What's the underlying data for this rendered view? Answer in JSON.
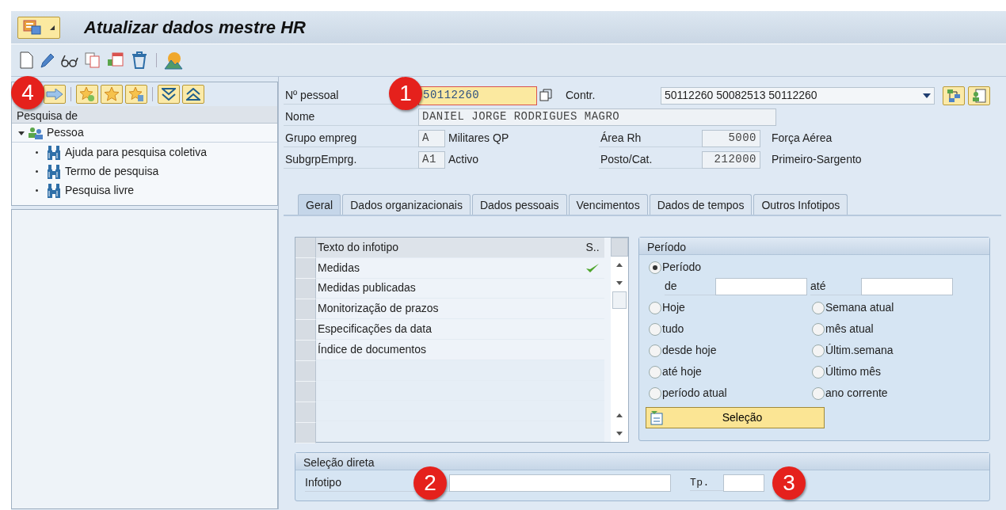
{
  "title_bar": {
    "title": "Atualizar dados mestre HR"
  },
  "search_panel": {
    "header": "Pesquisa de",
    "tree": [
      {
        "label": "Pessoa",
        "expanded": true,
        "children": [
          {
            "label": "Ajuda para pesquisa coletiva"
          },
          {
            "label": "Termo de pesquisa"
          },
          {
            "label": "Pesquisa livre"
          }
        ]
      }
    ]
  },
  "header": {
    "personnel_label": "Nº pessoal",
    "personnel_value": "50112260",
    "contract_label": "Contr.",
    "contract_value": "50112260 50082513 50112260",
    "name_label": "Nome",
    "name_value": "DANIEL JORGE RODRIGUES MAGRO",
    "rows": [
      {
        "label": "Grupo empreg",
        "code": "A",
        "text": "Militares QP",
        "label2": "Área Rh",
        "code2": "5000",
        "text2": "Força Aérea"
      },
      {
        "label": "SubgrpEmprg.",
        "code": "A1",
        "text": "Activo",
        "label2": "Posto/Cat.",
        "code2": "212000",
        "text2": "Primeiro-Sargento"
      }
    ]
  },
  "tabs": [
    {
      "label": "Geral",
      "selected": true
    },
    {
      "label": "Dados organizacionais",
      "selected": false
    },
    {
      "label": "Dados pessoais",
      "selected": false
    },
    {
      "label": "Vencimentos",
      "selected": false
    },
    {
      "label": "Dados de tempos",
      "selected": false
    },
    {
      "label": "Outros Infotipos",
      "selected": false
    }
  ],
  "infotype_table": {
    "columns": [
      "Texto do infotipo",
      "S.."
    ],
    "rows": [
      {
        "text": "Medidas",
        "checked": true
      },
      {
        "text": "Medidas publicadas",
        "checked": false
      },
      {
        "text": "Monitorização de prazos",
        "checked": false
      },
      {
        "text": "Especificações da data",
        "checked": false
      },
      {
        "text": "Índice de documentos",
        "checked": false
      }
    ]
  },
  "period": {
    "title": "Período",
    "from_label": "de",
    "to_label": "até",
    "options": [
      {
        "label": "Período",
        "selected": true
      },
      {
        "label": "Hoje",
        "selected": false
      },
      {
        "label": "Semana atual",
        "selected": false
      },
      {
        "label": "tudo",
        "selected": false
      },
      {
        "label": "mês atual",
        "selected": false
      },
      {
        "label": "desde hoje",
        "selected": false
      },
      {
        "label": "Últim.semana",
        "selected": false
      },
      {
        "label": "até hoje",
        "selected": false
      },
      {
        "label": "Último mês",
        "selected": false
      },
      {
        "label": "período atual",
        "selected": false
      },
      {
        "label": "ano corrente",
        "selected": false
      }
    ],
    "button": "Seleção"
  },
  "direct_selection": {
    "title": "Seleção direta",
    "infotype_label": "Infotipo",
    "type_label": "Tp."
  },
  "callouts": [
    "1",
    "2",
    "3",
    "4"
  ]
}
